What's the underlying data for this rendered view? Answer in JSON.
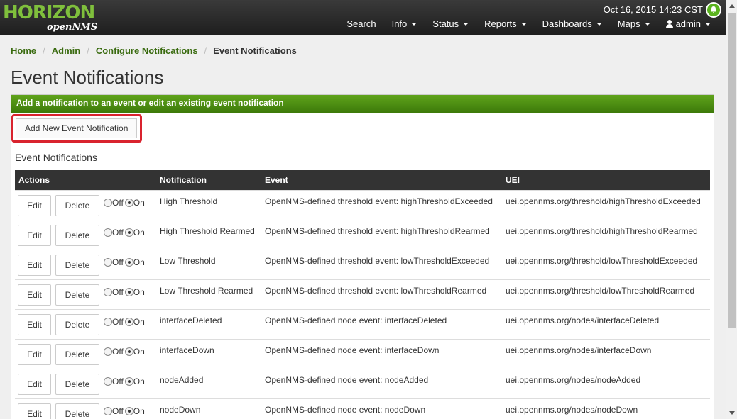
{
  "header": {
    "logo_main": "HORIZON",
    "logo_sub_prefix": "open",
    "logo_sub_suffix": "NMS",
    "datetime": "Oct 16, 2015 14:23 CST",
    "nav": {
      "search": "Search",
      "info": "Info",
      "status": "Status",
      "reports": "Reports",
      "dashboards": "Dashboards",
      "maps": "Maps",
      "user": "admin"
    }
  },
  "breadcrumb": {
    "home": "Home",
    "admin": "Admin",
    "configure": "Configure Notifications",
    "current": "Event Notifications"
  },
  "page_title": "Event Notifications",
  "panel": {
    "heading": "Add a notification to an event or edit an existing event notification",
    "add_button": "Add New Event Notification",
    "section_title": "Event Notifications"
  },
  "table": {
    "headers": [
      "Actions",
      "Notification",
      "Event",
      "UEI"
    ],
    "edit_label": "Edit",
    "delete_label": "Delete",
    "off_label": "Off",
    "on_label": "On",
    "rows": [
      {
        "notification": "High Threshold",
        "event": "OpenNMS-defined threshold event: highThresholdExceeded",
        "uei": "uei.opennms.org/threshold/highThresholdExceeded",
        "state": "On"
      },
      {
        "notification": "High Threshold Rearmed",
        "event": "OpenNMS-defined threshold event: highThresholdRearmed",
        "uei": "uei.opennms.org/threshold/highThresholdRearmed",
        "state": "On"
      },
      {
        "notification": "Low Threshold",
        "event": "OpenNMS-defined threshold event: lowThresholdExceeded",
        "uei": "uei.opennms.org/threshold/lowThresholdExceeded",
        "state": "On"
      },
      {
        "notification": "Low Threshold Rearmed",
        "event": "OpenNMS-defined threshold event: lowThresholdRearmed",
        "uei": "uei.opennms.org/threshold/lowThresholdRearmed",
        "state": "On"
      },
      {
        "notification": "interfaceDeleted",
        "event": "OpenNMS-defined node event: interfaceDeleted",
        "uei": "uei.opennms.org/nodes/interfaceDeleted",
        "state": "On"
      },
      {
        "notification": "interfaceDown",
        "event": "OpenNMS-defined node event: interfaceDown",
        "uei": "uei.opennms.org/nodes/interfaceDown",
        "state": "On"
      },
      {
        "notification": "nodeAdded",
        "event": "OpenNMS-defined node event: nodeAdded",
        "uei": "uei.opennms.org/nodes/nodeAdded",
        "state": "On"
      },
      {
        "notification": "nodeDown",
        "event": "OpenNMS-defined node event: nodeDown",
        "uei": "uei.opennms.org/nodes/nodeDown",
        "state": "On"
      }
    ]
  },
  "colors": {
    "brand_green": "#5fa31b",
    "highlight_red": "#d9232e",
    "navbar_dark": "#1e1e1e"
  },
  "icons": [
    "bell-icon",
    "user-icon",
    "caret-down-icon"
  ]
}
